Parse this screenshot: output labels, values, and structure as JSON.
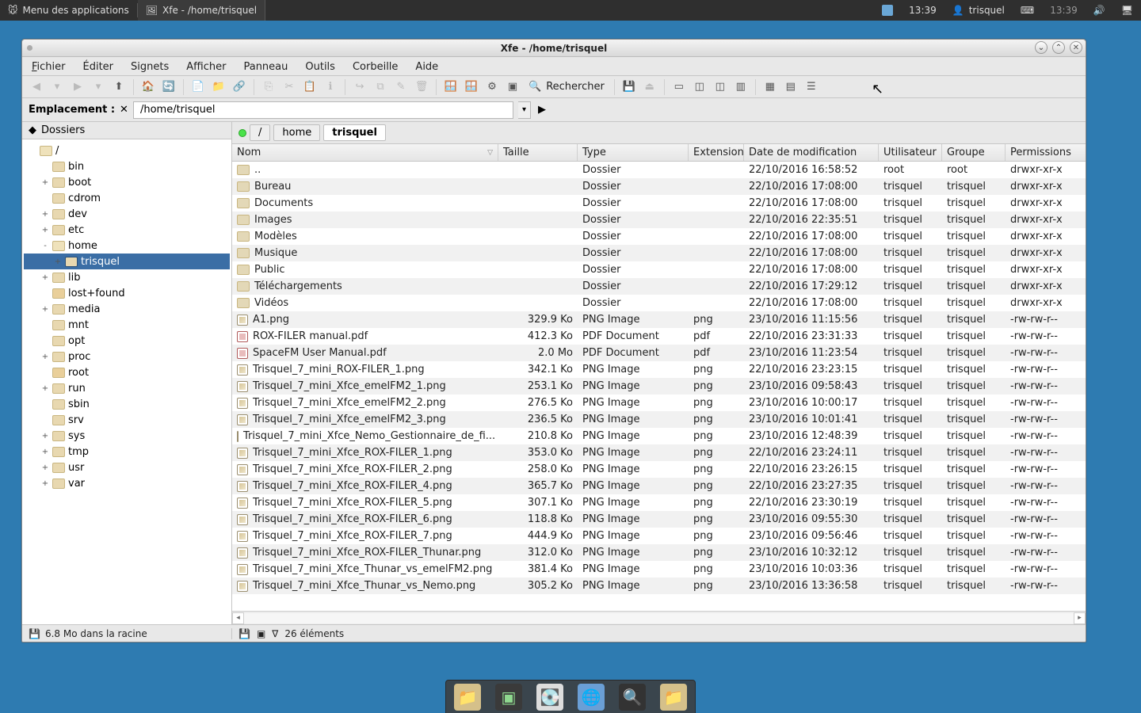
{
  "panel": {
    "menu_label": "Menu des applications",
    "task_label": "Xfe - /home/trisquel",
    "clock": "13:39",
    "user": "trisquel",
    "clock_dim": "13:39"
  },
  "window": {
    "title": "Xfe - /home/trisquel"
  },
  "menubar": {
    "file": "Fichier",
    "edit": "Éditer",
    "bookmarks": "Signets",
    "view": "Afficher",
    "panel": "Panneau",
    "tools": "Outils",
    "trash": "Corbeille",
    "help": "Aide"
  },
  "search_label": "Rechercher",
  "location_label": "Emplacement :",
  "location_value": "/home/trisquel",
  "side_head": "Dossiers",
  "tree": [
    {
      "d": 0,
      "exp": "",
      "name": "/",
      "sel": false,
      "open": true
    },
    {
      "d": 1,
      "exp": "",
      "name": "bin"
    },
    {
      "d": 1,
      "exp": "+",
      "name": "boot"
    },
    {
      "d": 1,
      "exp": "",
      "name": "cdrom"
    },
    {
      "d": 1,
      "exp": "+",
      "name": "dev"
    },
    {
      "d": 1,
      "exp": "+",
      "name": "etc"
    },
    {
      "d": 1,
      "exp": "-",
      "name": "home",
      "open": true
    },
    {
      "d": 2,
      "exp": "+",
      "name": "trisquel",
      "sel": true
    },
    {
      "d": 1,
      "exp": "+",
      "name": "lib"
    },
    {
      "d": 1,
      "exp": "",
      "name": "lost+found",
      "lock": true
    },
    {
      "d": 1,
      "exp": "+",
      "name": "media"
    },
    {
      "d": 1,
      "exp": "",
      "name": "mnt"
    },
    {
      "d": 1,
      "exp": "",
      "name": "opt"
    },
    {
      "d": 1,
      "exp": "+",
      "name": "proc"
    },
    {
      "d": 1,
      "exp": "",
      "name": "root",
      "lock": true
    },
    {
      "d": 1,
      "exp": "+",
      "name": "run"
    },
    {
      "d": 1,
      "exp": "",
      "name": "sbin"
    },
    {
      "d": 1,
      "exp": "",
      "name": "srv"
    },
    {
      "d": 1,
      "exp": "+",
      "name": "sys"
    },
    {
      "d": 1,
      "exp": "+",
      "name": "tmp"
    },
    {
      "d": 1,
      "exp": "+",
      "name": "usr"
    },
    {
      "d": 1,
      "exp": "+",
      "name": "var"
    }
  ],
  "crumbs": [
    "/",
    "home",
    "trisquel"
  ],
  "columns": {
    "nom": "Nom",
    "taille": "Taille",
    "type": "Type",
    "ext": "Extension",
    "date": "Date de modification",
    "user": "Utilisateur",
    "grp": "Groupe",
    "perm": "Permissions"
  },
  "files": [
    {
      "icon": "folder",
      "name": "..",
      "size": "",
      "type": "Dossier",
      "ext": "",
      "date": "22/10/2016 16:58:52",
      "user": "root",
      "grp": "root",
      "perm": "drwxr-xr-x"
    },
    {
      "icon": "folder",
      "name": "Bureau",
      "size": "",
      "type": "Dossier",
      "ext": "",
      "date": "22/10/2016 17:08:00",
      "user": "trisquel",
      "grp": "trisquel",
      "perm": "drwxr-xr-x"
    },
    {
      "icon": "folder",
      "name": "Documents",
      "size": "",
      "type": "Dossier",
      "ext": "",
      "date": "22/10/2016 17:08:00",
      "user": "trisquel",
      "grp": "trisquel",
      "perm": "drwxr-xr-x"
    },
    {
      "icon": "folder",
      "name": "Images",
      "size": "",
      "type": "Dossier",
      "ext": "",
      "date": "22/10/2016 22:35:51",
      "user": "trisquel",
      "grp": "trisquel",
      "perm": "drwxr-xr-x"
    },
    {
      "icon": "folder",
      "name": "Modèles",
      "size": "",
      "type": "Dossier",
      "ext": "",
      "date": "22/10/2016 17:08:00",
      "user": "trisquel",
      "grp": "trisquel",
      "perm": "drwxr-xr-x"
    },
    {
      "icon": "folder",
      "name": "Musique",
      "size": "",
      "type": "Dossier",
      "ext": "",
      "date": "22/10/2016 17:08:00",
      "user": "trisquel",
      "grp": "trisquel",
      "perm": "drwxr-xr-x"
    },
    {
      "icon": "folder",
      "name": "Public",
      "size": "",
      "type": "Dossier",
      "ext": "",
      "date": "22/10/2016 17:08:00",
      "user": "trisquel",
      "grp": "trisquel",
      "perm": "drwxr-xr-x"
    },
    {
      "icon": "folder",
      "name": "Téléchargements",
      "size": "",
      "type": "Dossier",
      "ext": "",
      "date": "22/10/2016 17:29:12",
      "user": "trisquel",
      "grp": "trisquel",
      "perm": "drwxr-xr-x"
    },
    {
      "icon": "folder",
      "name": "Vidéos",
      "size": "",
      "type": "Dossier",
      "ext": "",
      "date": "22/10/2016 17:08:00",
      "user": "trisquel",
      "grp": "trisquel",
      "perm": "drwxr-xr-x"
    },
    {
      "icon": "png",
      "name": "A1.png",
      "size": "329.9 Ko",
      "type": "PNG Image",
      "ext": "png",
      "date": "23/10/2016 11:15:56",
      "user": "trisquel",
      "grp": "trisquel",
      "perm": "-rw-rw-r--"
    },
    {
      "icon": "pdf",
      "name": "ROX-FILER manual.pdf",
      "size": "412.3 Ko",
      "type": "PDF Document",
      "ext": "pdf",
      "date": "22/10/2016 23:31:33",
      "user": "trisquel",
      "grp": "trisquel",
      "perm": "-rw-rw-r--"
    },
    {
      "icon": "pdf",
      "name": "SpaceFM User Manual.pdf",
      "size": "2.0 Mo",
      "type": "PDF Document",
      "ext": "pdf",
      "date": "23/10/2016 11:23:54",
      "user": "trisquel",
      "grp": "trisquel",
      "perm": "-rw-rw-r--"
    },
    {
      "icon": "png",
      "name": "Trisquel_7_mini_ROX-FILER_1.png",
      "size": "342.1 Ko",
      "type": "PNG Image",
      "ext": "png",
      "date": "22/10/2016 23:23:15",
      "user": "trisquel",
      "grp": "trisquel",
      "perm": "-rw-rw-r--"
    },
    {
      "icon": "png",
      "name": "Trisquel_7_mini_Xfce_emelFM2_1.png",
      "size": "253.1 Ko",
      "type": "PNG Image",
      "ext": "png",
      "date": "23/10/2016 09:58:43",
      "user": "trisquel",
      "grp": "trisquel",
      "perm": "-rw-rw-r--"
    },
    {
      "icon": "png",
      "name": "Trisquel_7_mini_Xfce_emelFM2_2.png",
      "size": "276.5 Ko",
      "type": "PNG Image",
      "ext": "png",
      "date": "23/10/2016 10:00:17",
      "user": "trisquel",
      "grp": "trisquel",
      "perm": "-rw-rw-r--"
    },
    {
      "icon": "png",
      "name": "Trisquel_7_mini_Xfce_emelFM2_3.png",
      "size": "236.5 Ko",
      "type": "PNG Image",
      "ext": "png",
      "date": "23/10/2016 10:01:41",
      "user": "trisquel",
      "grp": "trisquel",
      "perm": "-rw-rw-r--"
    },
    {
      "icon": "png",
      "name": "Trisquel_7_mini_Xfce_Nemo_Gestionnaire_de_fi...",
      "size": "210.8 Ko",
      "type": "PNG Image",
      "ext": "png",
      "date": "23/10/2016 12:48:39",
      "user": "trisquel",
      "grp": "trisquel",
      "perm": "-rw-rw-r--"
    },
    {
      "icon": "png",
      "name": "Trisquel_7_mini_Xfce_ROX-FILER_1.png",
      "size": "353.0 Ko",
      "type": "PNG Image",
      "ext": "png",
      "date": "22/10/2016 23:24:11",
      "user": "trisquel",
      "grp": "trisquel",
      "perm": "-rw-rw-r--"
    },
    {
      "icon": "png",
      "name": "Trisquel_7_mini_Xfce_ROX-FILER_2.png",
      "size": "258.0 Ko",
      "type": "PNG Image",
      "ext": "png",
      "date": "22/10/2016 23:26:15",
      "user": "trisquel",
      "grp": "trisquel",
      "perm": "-rw-rw-r--"
    },
    {
      "icon": "png",
      "name": "Trisquel_7_mini_Xfce_ROX-FILER_4.png",
      "size": "365.7 Ko",
      "type": "PNG Image",
      "ext": "png",
      "date": "22/10/2016 23:27:35",
      "user": "trisquel",
      "grp": "trisquel",
      "perm": "-rw-rw-r--"
    },
    {
      "icon": "png",
      "name": "Trisquel_7_mini_Xfce_ROX-FILER_5.png",
      "size": "307.1 Ko",
      "type": "PNG Image",
      "ext": "png",
      "date": "22/10/2016 23:30:19",
      "user": "trisquel",
      "grp": "trisquel",
      "perm": "-rw-rw-r--"
    },
    {
      "icon": "png",
      "name": "Trisquel_7_mini_Xfce_ROX-FILER_6.png",
      "size": "118.8 Ko",
      "type": "PNG Image",
      "ext": "png",
      "date": "23/10/2016 09:55:30",
      "user": "trisquel",
      "grp": "trisquel",
      "perm": "-rw-rw-r--"
    },
    {
      "icon": "png",
      "name": "Trisquel_7_mini_Xfce_ROX-FILER_7.png",
      "size": "444.9 Ko",
      "type": "PNG Image",
      "ext": "png",
      "date": "23/10/2016 09:56:46",
      "user": "trisquel",
      "grp": "trisquel",
      "perm": "-rw-rw-r--"
    },
    {
      "icon": "png",
      "name": "Trisquel_7_mini_Xfce_ROX-FILER_Thunar.png",
      "size": "312.0 Ko",
      "type": "PNG Image",
      "ext": "png",
      "date": "23/10/2016 10:32:12",
      "user": "trisquel",
      "grp": "trisquel",
      "perm": "-rw-rw-r--"
    },
    {
      "icon": "png",
      "name": "Trisquel_7_mini_Xfce_Thunar_vs_emelFM2.png",
      "size": "381.4 Ko",
      "type": "PNG Image",
      "ext": "png",
      "date": "23/10/2016 10:03:36",
      "user": "trisquel",
      "grp": "trisquel",
      "perm": "-rw-rw-r--"
    },
    {
      "icon": "png",
      "name": "Trisquel_7_mini_Xfce_Thunar_vs_Nemo.png",
      "size": "305.2 Ko",
      "type": "PNG Image",
      "ext": "png",
      "date": "23/10/2016 13:36:58",
      "user": "trisquel",
      "grp": "trisquel",
      "perm": "-rw-rw-r--"
    }
  ],
  "status_left": "6.8 Mo dans la racine",
  "status_right": "26 éléments"
}
